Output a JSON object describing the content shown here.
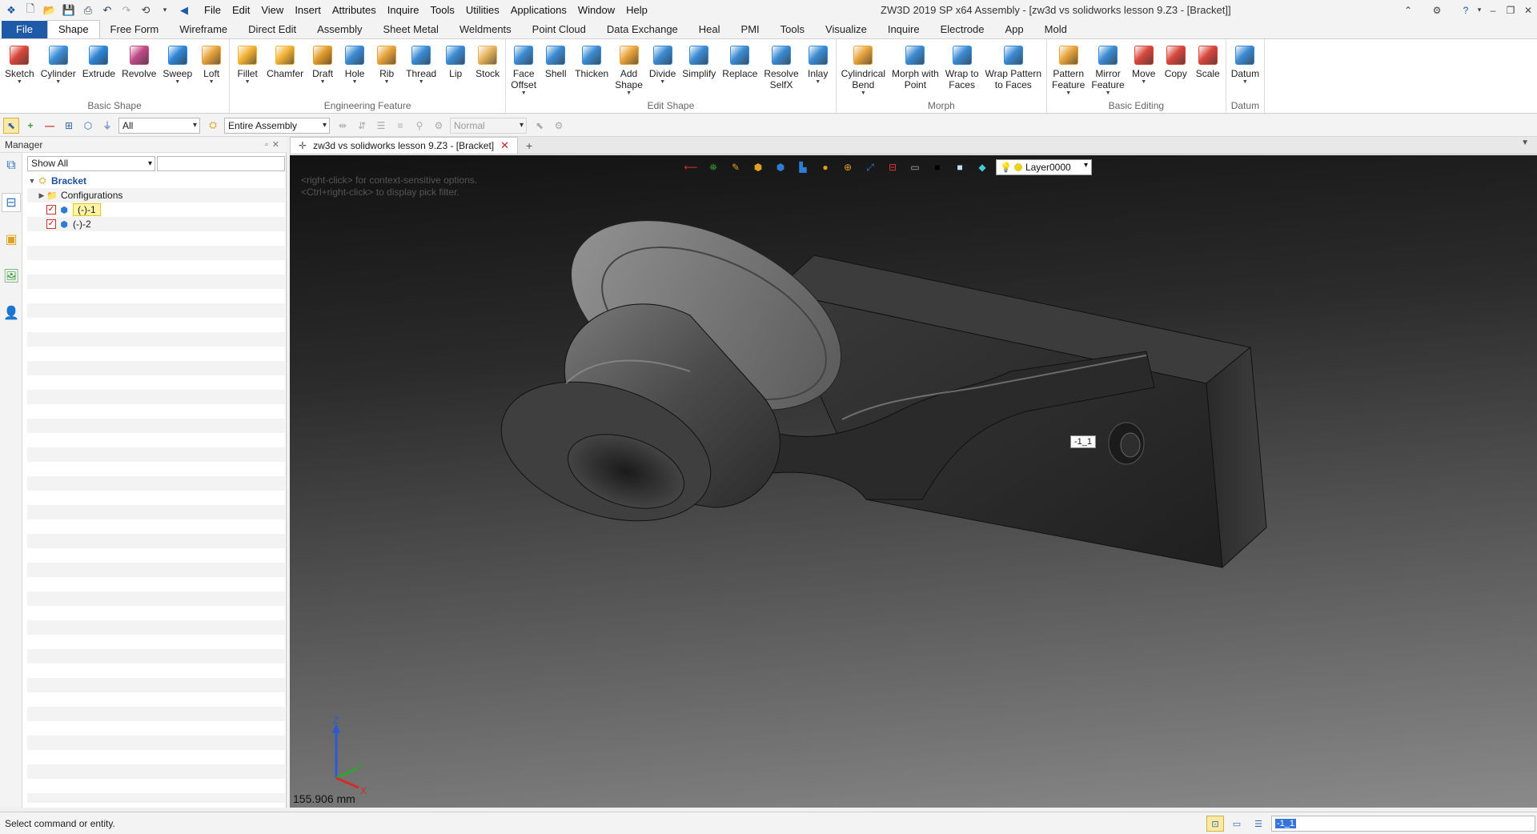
{
  "titlebar": {
    "menus": [
      "File",
      "Edit",
      "View",
      "Insert",
      "Attributes",
      "Inquire",
      "Tools",
      "Utilities",
      "Applications",
      "Window",
      "Help"
    ],
    "title": "ZW3D 2019 SP x64       Assembly - [zw3d vs solidworks lesson 9.Z3 - [Bracket]]"
  },
  "ribbon_tabs": [
    "File",
    "Shape",
    "Free Form",
    "Wireframe",
    "Direct Edit",
    "Assembly",
    "Sheet Metal",
    "Weldments",
    "Point Cloud",
    "Data Exchange",
    "Heal",
    "PMI",
    "Tools",
    "Visualize",
    "Inquire",
    "Electrode",
    "App",
    "Mold"
  ],
  "ribbon_groups": [
    {
      "title": "Basic Shape",
      "buttons": [
        {
          "label": "Sketch",
          "arrow": true,
          "color": "#d8473c"
        },
        {
          "label": "Cylinder",
          "arrow": true,
          "color": "#3b8fd8"
        },
        {
          "label": "Extrude",
          "arrow": false,
          "color": "#2e86d6"
        },
        {
          "label": "Revolve",
          "arrow": false,
          "color": "#c14a88"
        },
        {
          "label": "Sweep",
          "arrow": true,
          "color": "#2e86d6"
        },
        {
          "label": "Loft",
          "arrow": true,
          "color": "#e8a33a"
        }
      ]
    },
    {
      "title": "Engineering Feature",
      "buttons": [
        {
          "label": "Fillet",
          "arrow": true,
          "color": "#f2b233"
        },
        {
          "label": "Chamfer",
          "arrow": false,
          "color": "#f2b233"
        },
        {
          "label": "Draft",
          "arrow": true,
          "color": "#e39b2a"
        },
        {
          "label": "Hole",
          "arrow": true,
          "color": "#3a8bd4"
        },
        {
          "label": "Rib",
          "arrow": true,
          "color": "#e8a33a"
        },
        {
          "label": "Thread",
          "arrow": true,
          "color": "#3a8bd4"
        },
        {
          "label": "Lip",
          "arrow": false,
          "color": "#3a8bd4"
        },
        {
          "label": "Stock",
          "arrow": false,
          "color": "#e7b45b"
        }
      ]
    },
    {
      "title": "Edit Shape",
      "buttons": [
        {
          "label": "Face\nOffset",
          "arrow": true,
          "color": "#3a8bd4"
        },
        {
          "label": "Shell",
          "arrow": false,
          "color": "#3a8bd4"
        },
        {
          "label": "Thicken",
          "arrow": false,
          "color": "#3a8bd4"
        },
        {
          "label": "Add\nShape",
          "arrow": true,
          "color": "#e8a33a"
        },
        {
          "label": "Divide",
          "arrow": true,
          "color": "#3a8bd4"
        },
        {
          "label": "Simplify",
          "arrow": false,
          "color": "#3a8bd4"
        },
        {
          "label": "Replace",
          "arrow": false,
          "color": "#3a8bd4"
        },
        {
          "label": "Resolve\nSelfX",
          "arrow": false,
          "color": "#3a8bd4"
        },
        {
          "label": "Inlay",
          "arrow": true,
          "color": "#3a8bd4"
        }
      ]
    },
    {
      "title": "Morph",
      "buttons": [
        {
          "label": "Cylindrical\nBend",
          "arrow": true,
          "color": "#e8a33a"
        },
        {
          "label": "Morph with\nPoint",
          "arrow": false,
          "color": "#3a8bd4"
        },
        {
          "label": "Wrap to\nFaces",
          "arrow": false,
          "color": "#3a8bd4"
        },
        {
          "label": "Wrap Pattern\nto Faces",
          "arrow": false,
          "color": "#3a8bd4"
        }
      ]
    },
    {
      "title": "Basic Editing",
      "buttons": [
        {
          "label": "Pattern\nFeature",
          "arrow": true,
          "color": "#e8a33a"
        },
        {
          "label": "Mirror\nFeature",
          "arrow": true,
          "color": "#3a8bd4"
        },
        {
          "label": "Move",
          "arrow": true,
          "color": "#d8473c"
        },
        {
          "label": "Copy",
          "arrow": false,
          "color": "#d8473c"
        },
        {
          "label": "Scale",
          "arrow": false,
          "color": "#d8473c"
        }
      ]
    },
    {
      "title": "Datum",
      "buttons": [
        {
          "label": "Datum",
          "arrow": true,
          "color": "#3a8bd4"
        }
      ]
    }
  ],
  "toolbar2": {
    "filter_value": "All",
    "scope_value": "Entire Assembly",
    "mode_value": "Normal"
  },
  "manager": {
    "title": "Manager",
    "filter_value": "Show All",
    "tree": {
      "root": "Bracket",
      "configurations": "Configurations",
      "parts": [
        "(-)-1",
        "(-)-2"
      ]
    }
  },
  "document_tab": {
    "label": "zw3d vs solidworks lesson 9.Z3 - [Bracket]"
  },
  "viewport": {
    "hint_line1": "<right-click> for context-sensitive options.",
    "hint_line2": "<Ctrl+right-click> to display pick filter.",
    "layer": "Layer0000",
    "part_label": "-1_1",
    "scale_readout": "155.906 mm",
    "axis_x": "X",
    "axis_y": "Y",
    "axis_z": "Z"
  },
  "status": {
    "text": "Select command or entity.",
    "command_value": "-1_1"
  }
}
